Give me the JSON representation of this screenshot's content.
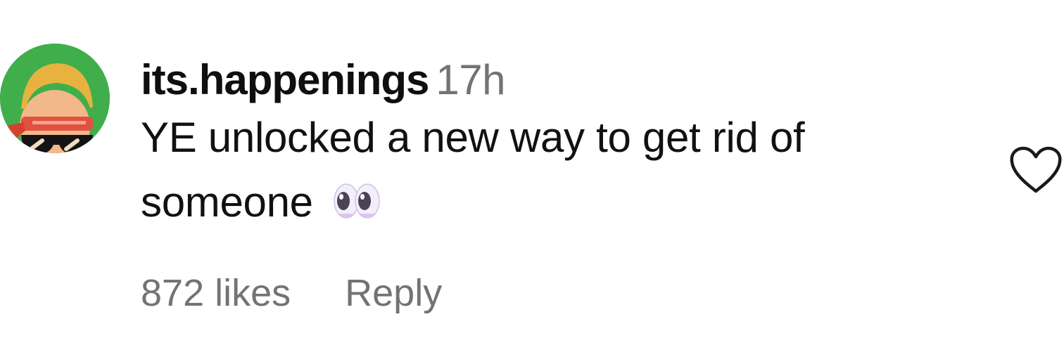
{
  "comment": {
    "username": "its.happenings",
    "timestamp": "17h",
    "text": "YE unlocked a new way to get rid of someone",
    "emoji_icon": "eyes-emoji",
    "likes_label": "872 likes",
    "reply_label": "Reply",
    "like_icon": "heart-outline-icon",
    "avatar_icon": "cartoon-avatar-with-sunglasses-and-headband"
  },
  "colors": {
    "background": "#ffffff",
    "primary_text": "#111111",
    "secondary_text": "#737373",
    "avatar_background": "#3fae4b"
  }
}
